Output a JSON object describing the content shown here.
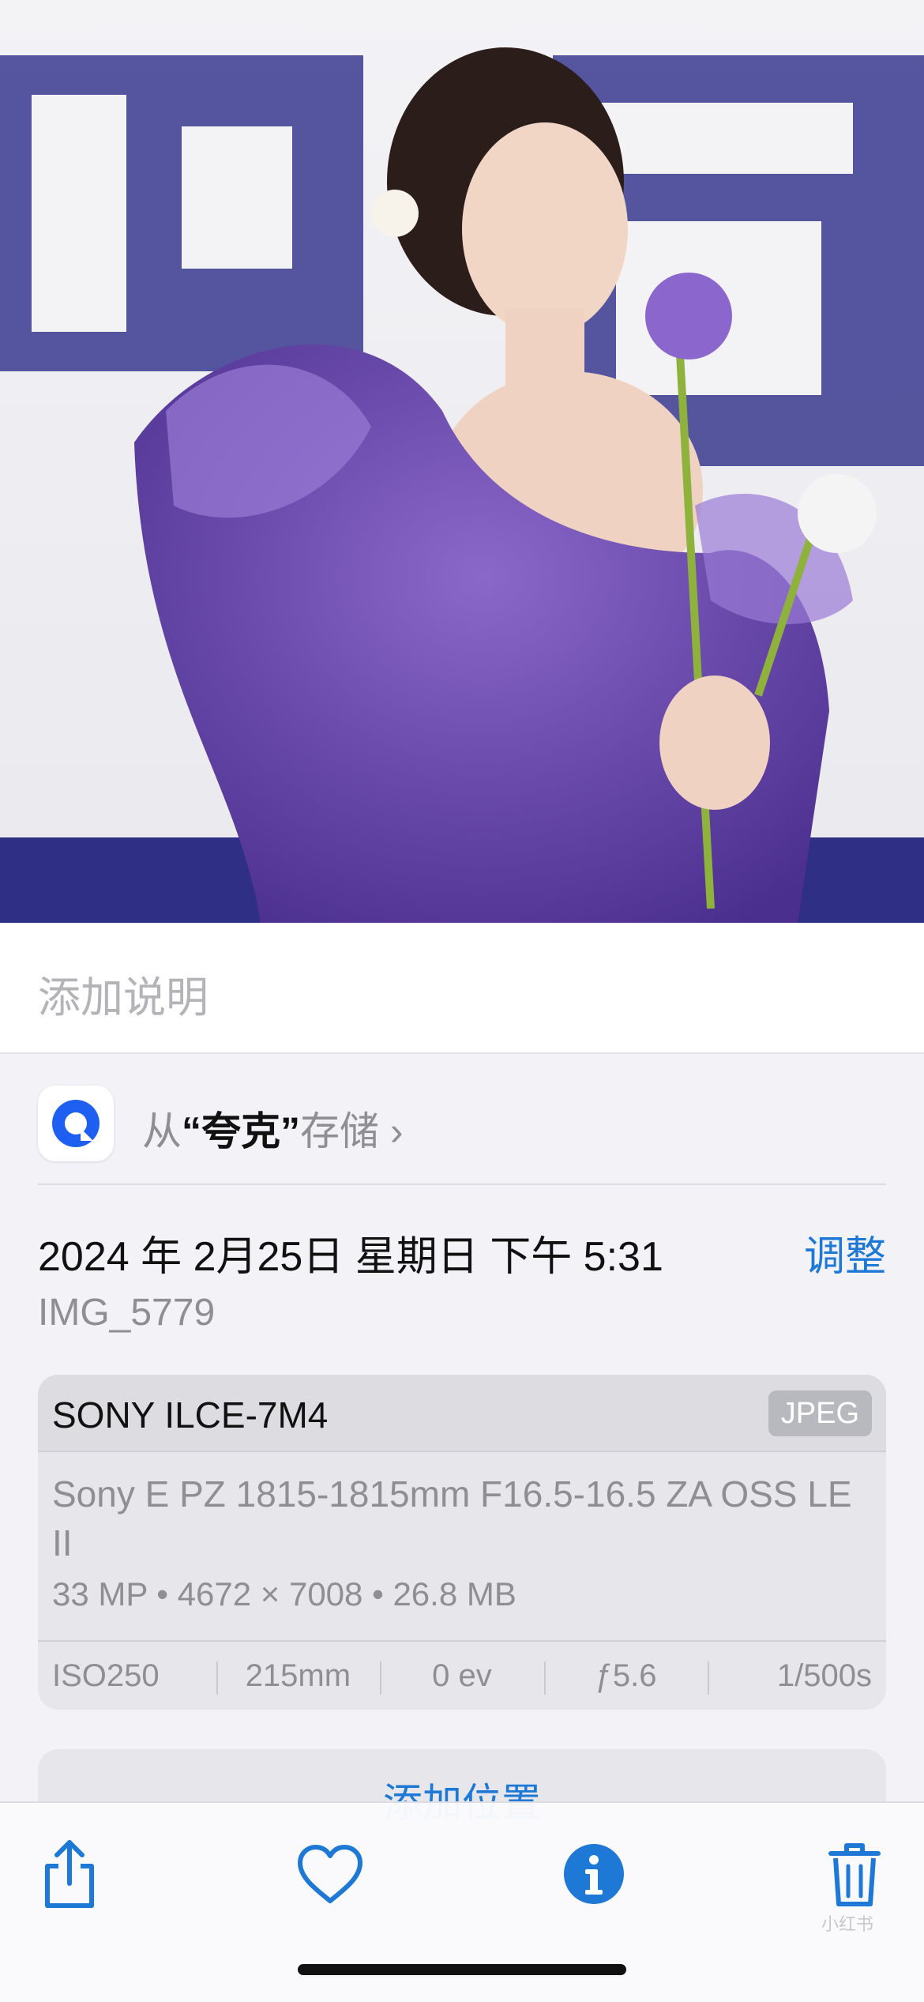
{
  "caption": {
    "placeholder": "添加说明"
  },
  "source": {
    "prefix": "从",
    "app_name": "“夸克”",
    "suffix": "存储",
    "chevron": "›",
    "icon": "quark-app-icon"
  },
  "info": {
    "datetime": "2024 年 2月25日 星期日 下午 5:31",
    "adjust_label": "调整",
    "filename": "IMG_5779"
  },
  "exif": {
    "camera": "SONY ILCE-7M4",
    "format": "JPEG",
    "lens": "Sony E PZ 1815-1815mm F16.5-16.5 ZA OSS LE II",
    "specs": "33 MP • 4672 × 7008 • 26.8 MB",
    "iso": "ISO250",
    "focal": "215mm",
    "ev": "0 ev",
    "aperture": "ƒ5.6",
    "shutter": "1/500s"
  },
  "location": {
    "add_label": "添加位置"
  },
  "toolbar": {
    "share_icon": "share-icon",
    "favorite_icon": "heart-icon",
    "info_icon": "info-icon",
    "delete_icon": "trash-icon"
  },
  "watermark": "小红书",
  "colors": {
    "accent": "#1e78d6",
    "secondary_text": "#8e8e93",
    "background": "#f2f2f7"
  }
}
